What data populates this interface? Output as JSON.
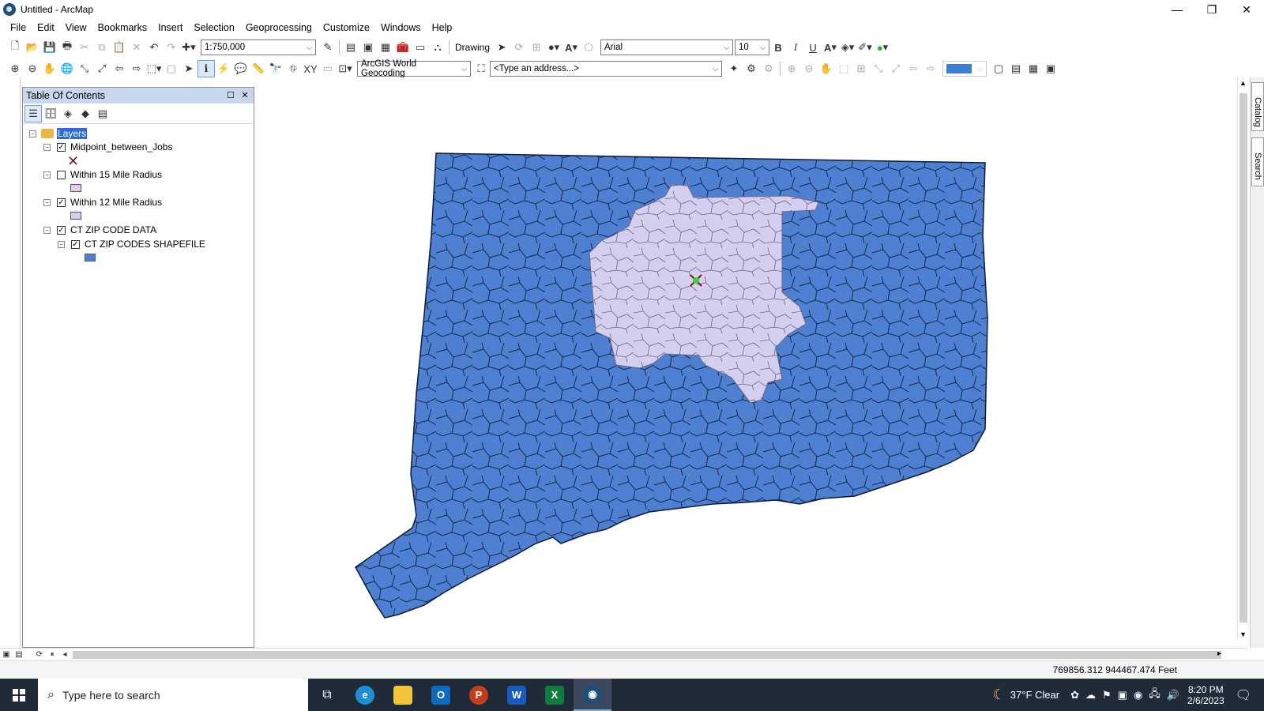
{
  "window": {
    "title": "Untitled - ArcMap",
    "minimize": "—",
    "restore": "❐",
    "close": "✕"
  },
  "menu": [
    "File",
    "Edit",
    "View",
    "Bookmarks",
    "Insert",
    "Selection",
    "Geoprocessing",
    "Customize",
    "Windows",
    "Help"
  ],
  "toolbar": {
    "scale": "1:750,000",
    "drawing_label": "Drawing",
    "font_name": "Arial",
    "font_size": "10",
    "bold": "B",
    "italic": "I",
    "underline": "U",
    "geocoder": "ArcGIS World Geocoding",
    "address_placeholder": "<Type an address...>"
  },
  "toc": {
    "title": "Table Of Contents",
    "root": "Layers",
    "layers": [
      {
        "name": "Midpoint_between_Jobs",
        "checked": true
      },
      {
        "name": "Within 15 Mile Radius",
        "checked": false
      },
      {
        "name": "Within 12 Mile Radius",
        "checked": true
      },
      {
        "name": "CT ZIP CODE DATA",
        "checked": true
      },
      {
        "name": "CT ZIP CODES SHAPEFILE",
        "checked": true
      }
    ]
  },
  "colors": {
    "zip_fill": "#4f7fd1",
    "radius12_fill": "#d4cfee",
    "radius15_fill": "#f0c8ec",
    "midpoint": "#7a1a1a"
  },
  "side_tabs": {
    "catalog": "Catalog",
    "search": "Search"
  },
  "status": {
    "coordinates": "769856.312  944467.474 Feet"
  },
  "taskbar": {
    "search_placeholder": "Type here to search",
    "weather": "37°F  Clear",
    "time": "8:20 PM",
    "date": "2/6/2023"
  }
}
